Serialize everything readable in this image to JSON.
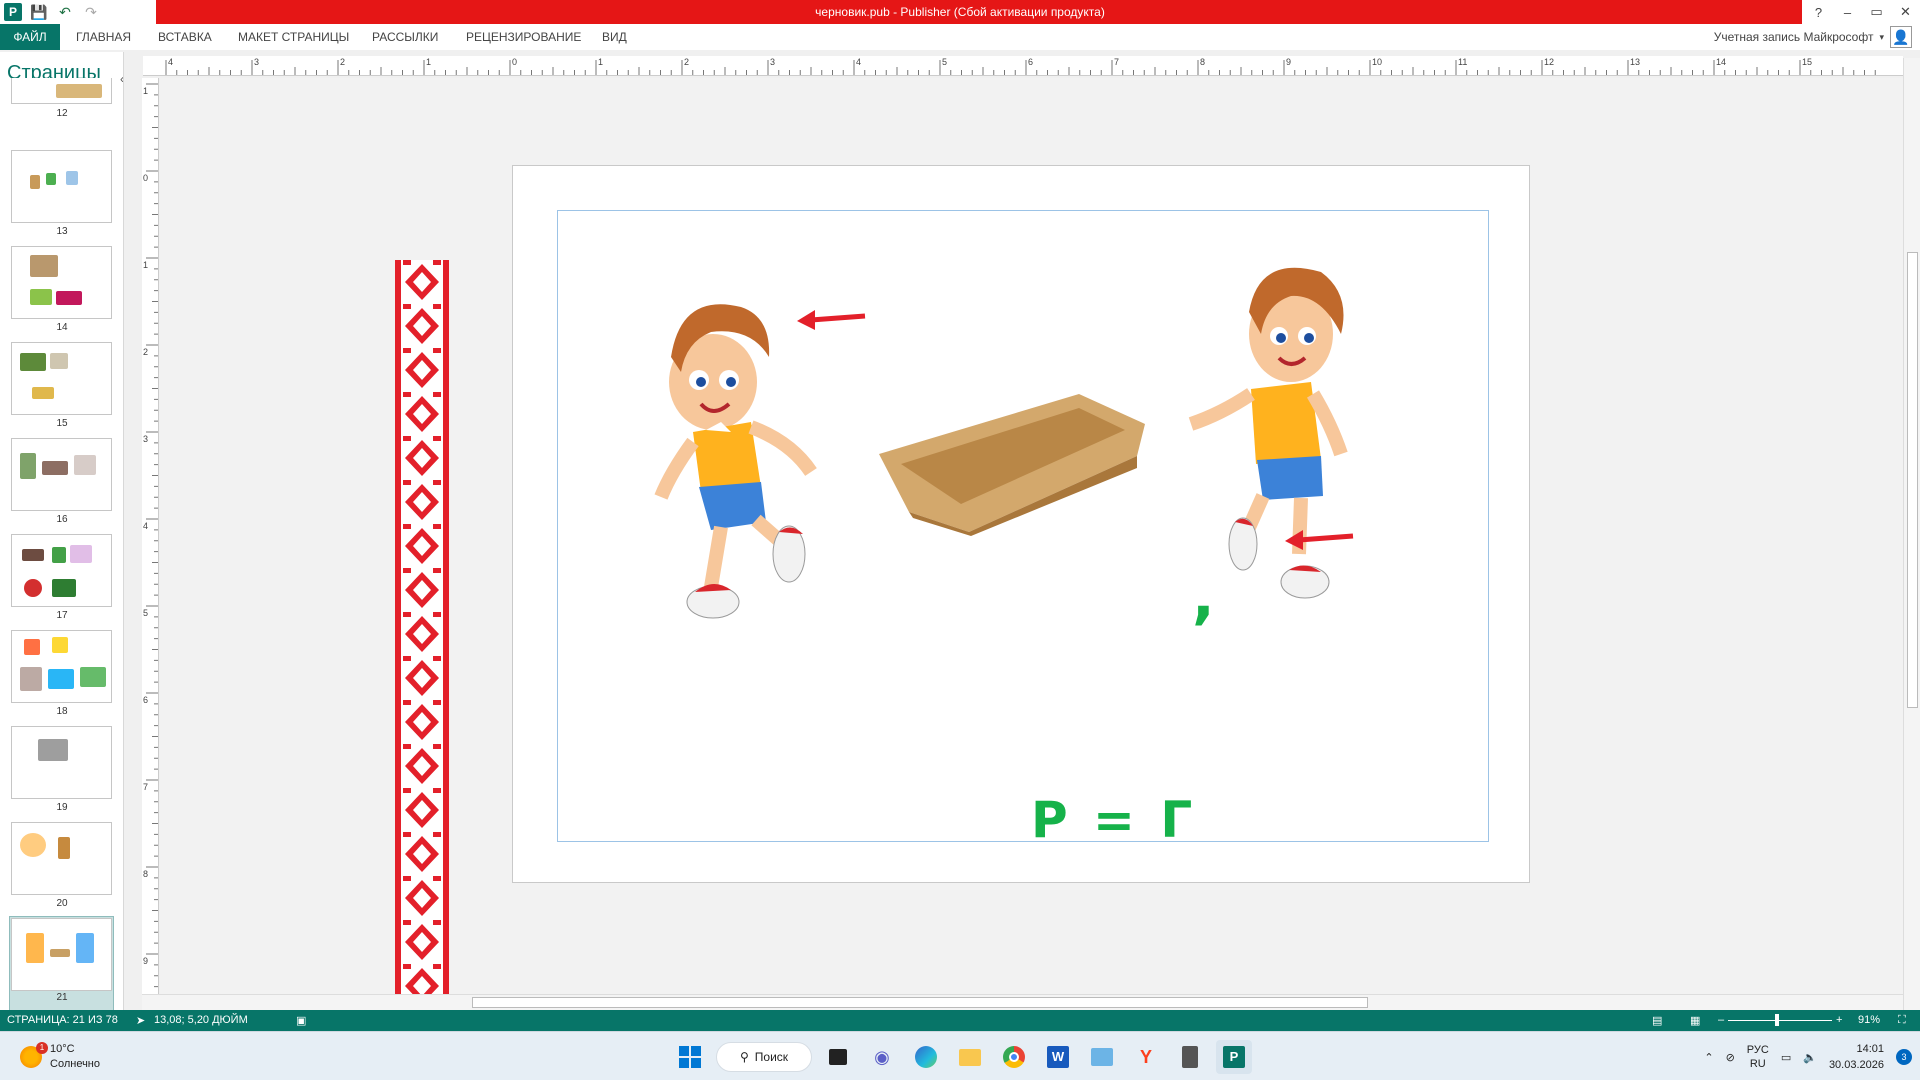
{
  "window": {
    "title": "черновик.pub -  Publisher (Сбой активации продукта)",
    "controls": [
      "?",
      "–",
      "▭",
      "✕"
    ]
  },
  "ribbon": {
    "tabs": [
      "ФАЙЛ",
      "ГЛАВНАЯ",
      "ВСТАВКА",
      "МАКЕТ СТРАНИЦЫ",
      "РАССЫЛКИ",
      "РЕЦЕНЗИРОВАНИЕ",
      "ВИД"
    ],
    "account": "Учетная запись Майкрософт"
  },
  "pages_pane": {
    "title": "Страницы",
    "thumbnails": [
      "12",
      "13",
      "14",
      "15",
      "16",
      "17",
      "18",
      "19",
      "20",
      "21"
    ],
    "selected": "21"
  },
  "rulers": {
    "horizontal": [
      "4",
      "3",
      "2",
      "1",
      "0",
      "1",
      "2",
      "3",
      "4",
      "5",
      "6",
      "7",
      "8",
      "9",
      "10",
      "11",
      "12",
      "13",
      "14",
      "15"
    ],
    "vertical": [
      "1",
      "0",
      "1",
      "2",
      "3",
      "4",
      "5",
      "6",
      "7",
      "8",
      "9"
    ]
  },
  "slide": {
    "equation": "Р = Г",
    "comma": ","
  },
  "status": {
    "page": "СТРАНИЦА: 21 ИЗ 78",
    "position": "13,08; 5,20 ДЮЙМ",
    "zoom": "91%"
  },
  "taskbar": {
    "weather_temp": "10°C",
    "weather_desc": "Солнечно",
    "weather_badge": "1",
    "search": "Поиск",
    "lang_top": "РУС",
    "lang_bottom": "RU",
    "time": "14:01",
    "date": "30.03.2026",
    "notifications": "3"
  },
  "colors": {
    "accent": "#077568",
    "titlebar_red": "#e51616",
    "letters_green": "#16b24a",
    "ornament_red": "#e3202a"
  }
}
